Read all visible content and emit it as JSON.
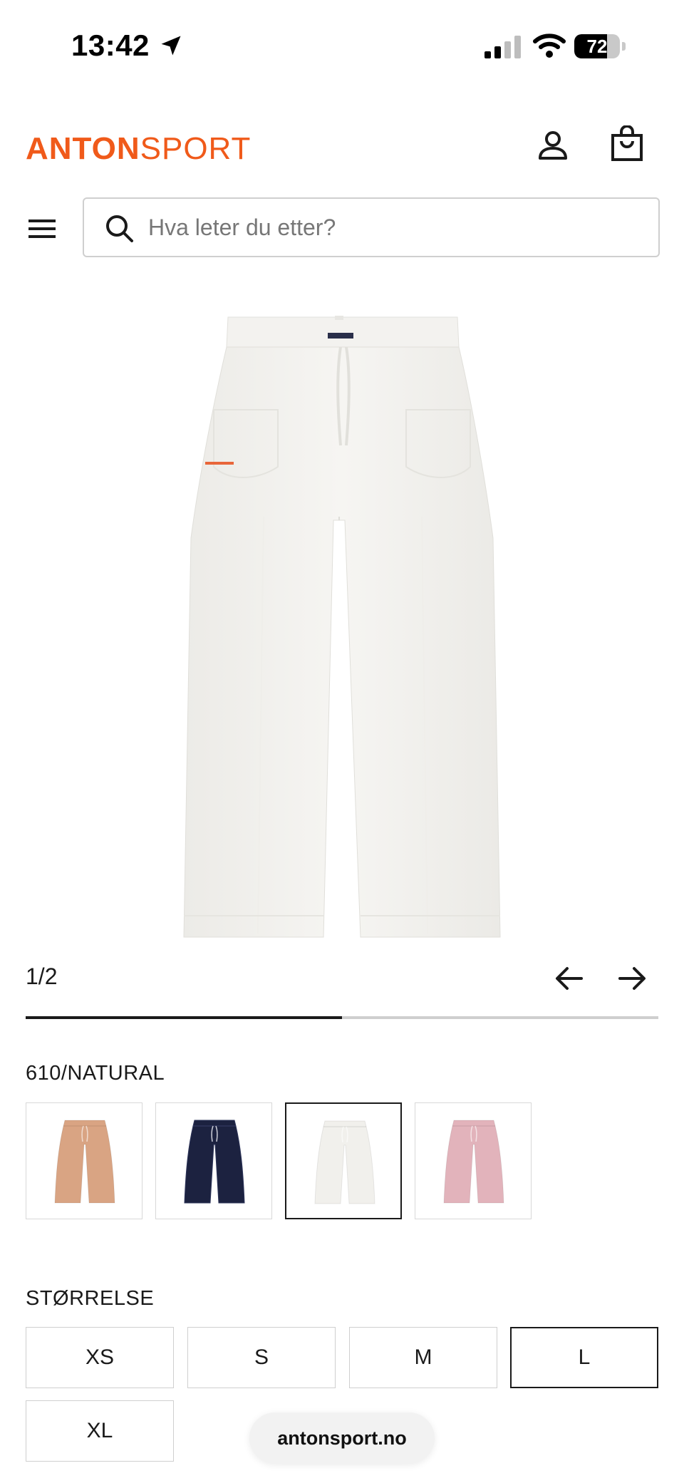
{
  "status_bar": {
    "time": "13:42",
    "battery_level": "72",
    "battery_fraction": 0.72
  },
  "header": {
    "logo_part1": "ANTON",
    "logo_part2": "SPORT",
    "brand_color": "#f05a1a"
  },
  "search": {
    "placeholder": "Hva leter du etter?"
  },
  "gallery": {
    "counter": "1/2",
    "current": 1,
    "total": 2,
    "progress_fraction": 0.5
  },
  "color": {
    "selected_label": "610/NATURAL",
    "variants": [
      {
        "name": "tan",
        "color": "#d9a483",
        "selected": false
      },
      {
        "name": "navy",
        "color": "#1c2240",
        "selected": false
      },
      {
        "name": "natural",
        "color": "#f1f0ec",
        "selected": true
      },
      {
        "name": "pink",
        "color": "#e2b3bb",
        "selected": false
      }
    ]
  },
  "size": {
    "label": "STØRRELSE",
    "options": [
      "XS",
      "S",
      "M",
      "L",
      "XL"
    ],
    "selected": "L"
  },
  "browser": {
    "url": "antonsport.no"
  },
  "icons": [
    "location-arrow-icon",
    "signal-icon",
    "wifi-icon",
    "battery-icon",
    "account-icon",
    "shopping-bag-icon",
    "menu-icon",
    "search-icon",
    "arrow-left-icon",
    "arrow-right-icon"
  ]
}
